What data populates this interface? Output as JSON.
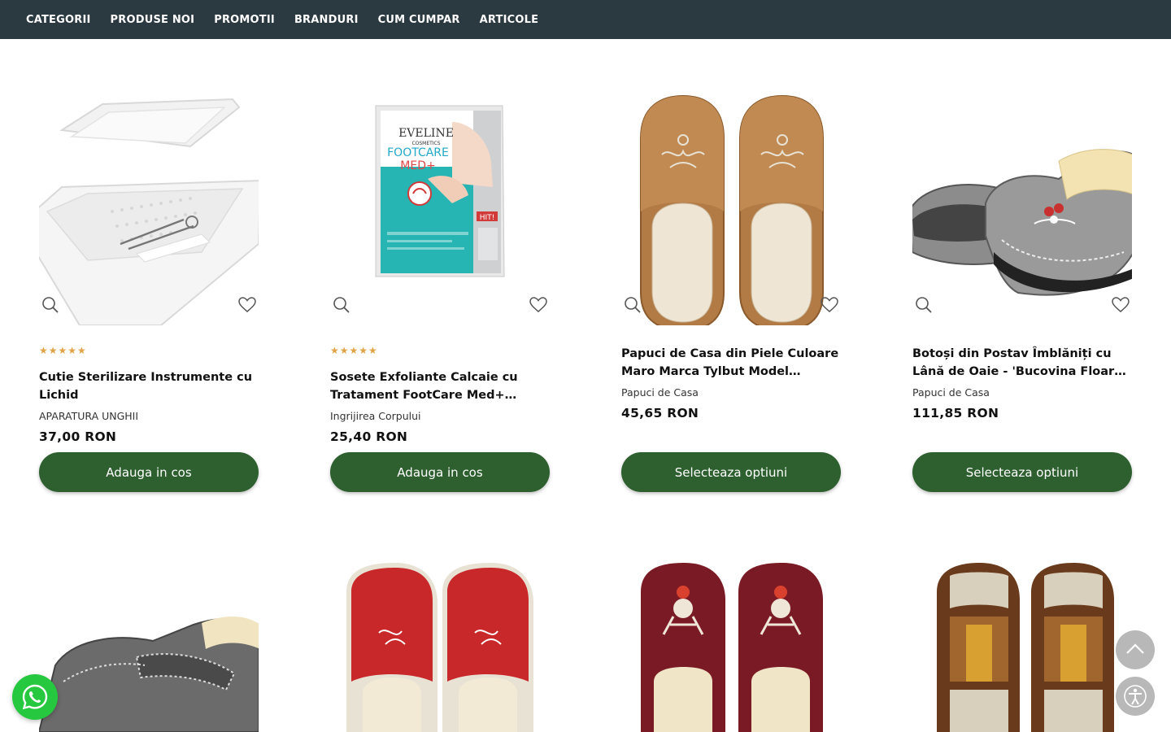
{
  "nav": {
    "items": [
      "CATEGORII",
      "PRODUSE NOI",
      "PROMOTII",
      "BRANDURI",
      "CUM CUMPAR",
      "ARTICOLE"
    ]
  },
  "products": [
    {
      "rating": "★★★★★",
      "title": "Cutie Sterilizare Instrumente cu Lichid",
      "category": "APARATURA UNGHII",
      "price": "37,00 RON",
      "button": "Adauga in cos"
    },
    {
      "rating": "★★★★★",
      "title": "Sosete Exfoliante Calcaie cu Tratament FootCare Med+…",
      "category": "Ingrijirea Corpului",
      "price": "25,40 RON",
      "button": "Adauga in cos",
      "image_text": {
        "brand": "EVELINE",
        "brand_sub": "COSMETICS",
        "product_line_1": "FOOTCARE",
        "product_line_2": "MED+",
        "badge": "HIT!"
      }
    },
    {
      "rating": "",
      "title": "Papuci de Casa din Piele Culoare Maro Marca Tylbut Model…",
      "category": "Papuci de Casa",
      "price": "45,65 RON",
      "button": "Selecteaza optiuni"
    },
    {
      "rating": "",
      "title": "Botoși din Postav Îmblăniți cu Lână de Oaie - 'Bucovina Floar…",
      "category": "Papuci de Casa",
      "price": "111,85 RON",
      "button": "Selecteaza optiuni"
    }
  ],
  "colors": {
    "nav_bg": "#2b3940",
    "button_green": "#2d5f2f",
    "star": "#e0a347",
    "whatsapp": "#26c840",
    "floating_gray": "#b8b8b8"
  },
  "icons": [
    "search-icon",
    "heart-icon",
    "whatsapp-icon",
    "chevron-up-icon",
    "accessibility-icon"
  ]
}
